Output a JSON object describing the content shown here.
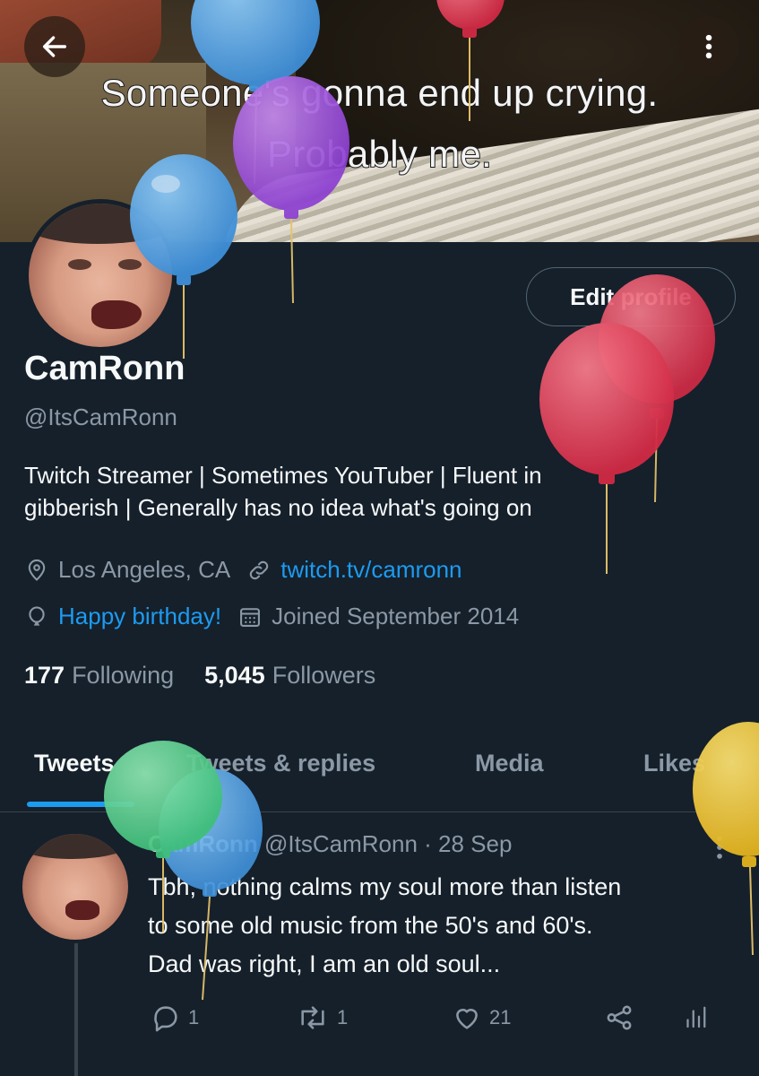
{
  "banner": {
    "caption_line1": "Someone's gonna end up crying.",
    "caption_line2": "Probably me."
  },
  "header": {
    "back_icon": "arrow-left-icon",
    "more_icon": "more-vertical-icon"
  },
  "profile": {
    "edit_label": "Edit profile",
    "name": "CamRonn",
    "handle": "@ItsCamRonn",
    "bio_line1": "Twitch Streamer | Sometimes YouTuber | Fluent in",
    "bio_line2": "gibberish | Generally has no idea what's going on",
    "location": "Los Angeles, CA",
    "website": "twitch.tv/camronn",
    "birthday": "Happy birthday!",
    "joined": "Joined September 2014",
    "following_count": "177",
    "following_label": "Following",
    "followers_count": "5,045",
    "followers_label": "Followers"
  },
  "tabs": [
    {
      "label": "Tweets",
      "active": true
    },
    {
      "label": "Tweets & replies",
      "active": false
    },
    {
      "label": "Media",
      "active": false
    },
    {
      "label": "Likes",
      "active": false
    }
  ],
  "tweet": {
    "author": "CamRonn",
    "handle_date": "@ItsCamRonn · 28 Sep",
    "text_line1": "Tbh, nothing calms my soul more than listen",
    "text_line2": "to some old music from the 50's and 60's.",
    "text_line3": "Dad was right, I am an old soul...",
    "replies": "1",
    "retweets": "1",
    "likes": "21"
  },
  "colors": {
    "background": "#15202b",
    "accent": "#1d9bf0",
    "muted": "#8b98a5"
  }
}
